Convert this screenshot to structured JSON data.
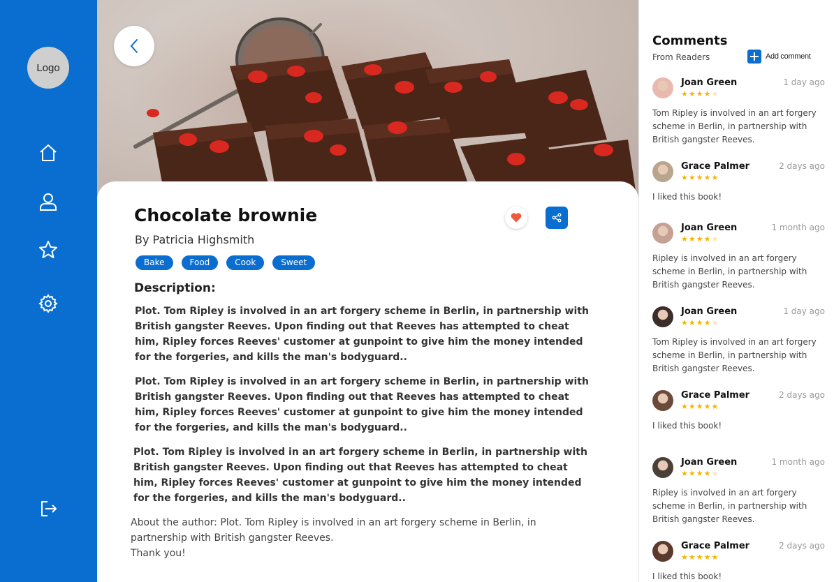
{
  "sidebar": {
    "logo": "Logo",
    "nav": [
      {
        "icon": "home-icon"
      },
      {
        "icon": "user-icon"
      },
      {
        "icon": "star-icon"
      },
      {
        "icon": "settings-icon"
      }
    ],
    "logout_icon": "logout-icon"
  },
  "colors": {
    "accent": "#0a6ed1",
    "heart": "#ef5a3c",
    "star": "#f5b400"
  },
  "recipe": {
    "title": "Chocolate brownie",
    "author": "By Patricia Highsmith",
    "tags": [
      "Bake",
      "Food",
      "Cook",
      "Sweet"
    ],
    "description_heading": "Description:",
    "paragraphs": [
      "Plot. Tom Ripley is involved in an art forgery scheme in Berlin, in partnership with British gangster Reeves. Upon finding out that Reeves has attempted to cheat him, Ripley forces Reeves' customer at gunpoint to give him the money intended for the forgeries, and kills the man's bodyguard..",
      "Plot. Tom Ripley is involved in an art forgery scheme in Berlin, in partnership with British gangster Reeves. Upon finding out that Reeves has attempted to cheat him, Ripley forces Reeves' customer at gunpoint to give him the money intended for the forgeries, and kills the man's bodyguard..",
      "Plot. Tom Ripley is involved in an art forgery scheme in Berlin, in partnership with British gangster Reeves. Upon finding out that Reeves has attempted to cheat him, Ripley forces Reeves' customer at gunpoint to give him the money intended for the forgeries, and kills the man's bodyguard.."
    ],
    "about_label": "About the author",
    "about_text": ": Plot. Tom Ripley is involved in an art forgery scheme in Berlin, in partnership with British gangster Reeves.",
    "thanks": "Thank you!"
  },
  "comments": {
    "title": "Comments",
    "subtitle": "From Readers",
    "add_label": "Add comment",
    "items": [
      {
        "name": "Joan Green",
        "time": "1 day ago",
        "rating": 4,
        "text": "Tom Ripley is involved in an art forgery scheme in Berlin, in partnership with British gangster Reeves."
      },
      {
        "name": "Grace Palmer",
        "time": "2 days ago",
        "rating": 5,
        "text": "I liked this book!"
      },
      {
        "name": "Joan Green",
        "time": "1 month ago",
        "rating": 4,
        "text": "Ripley is involved in an art forgery scheme in Berlin, in partnership with British gangster Reeves."
      },
      {
        "name": "Joan Green",
        "time": "1 day ago",
        "rating": 4,
        "text": "Tom Ripley is involved in an art forgery scheme in Berlin, in partnership with British gangster Reeves."
      },
      {
        "name": "Grace Palmer",
        "time": "2 days ago",
        "rating": 5,
        "text": "I liked this book!"
      },
      {
        "name": "Joan Green",
        "time": "1 month ago",
        "rating": 4,
        "text": "Ripley is involved in an art forgery scheme in Berlin, in partnership with British gangster Reeves."
      },
      {
        "name": "Grace Palmer",
        "time": "2 days ago",
        "rating": 5,
        "text": "I liked this book!"
      }
    ]
  }
}
